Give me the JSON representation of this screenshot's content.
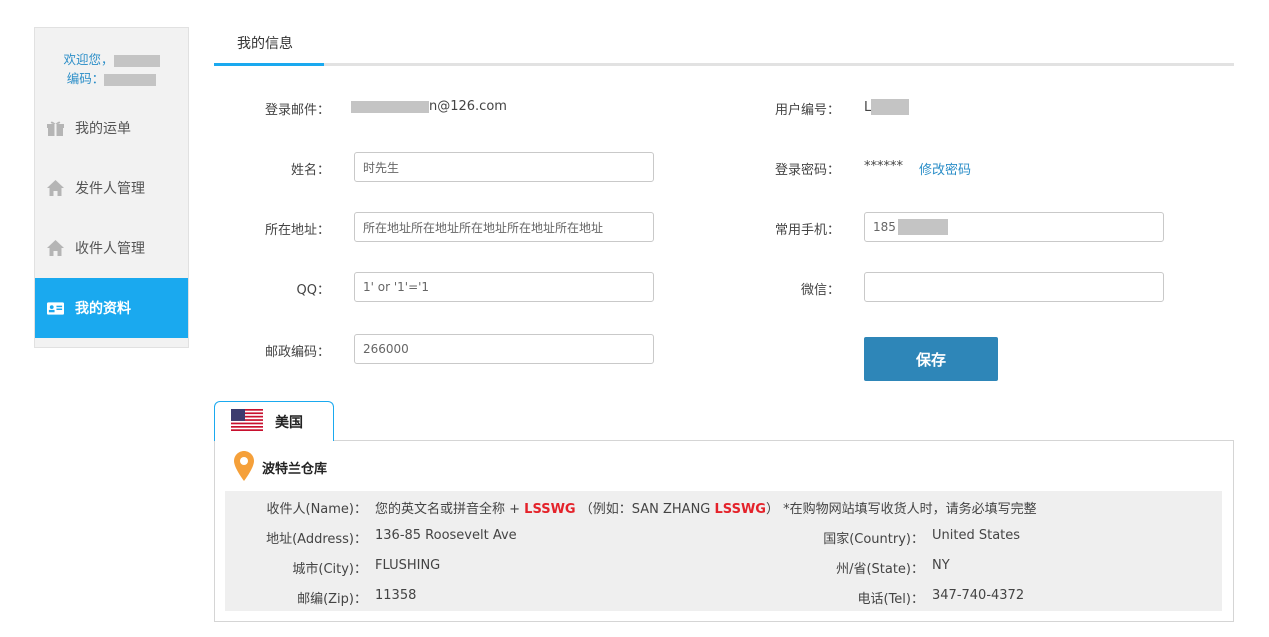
{
  "sidebar": {
    "welcome_label": "欢迎您，",
    "code_label": "编码：",
    "items": [
      {
        "label": "我的运单",
        "icon": "gift-icon"
      },
      {
        "label": "发件人管理",
        "icon": "home-icon"
      },
      {
        "label": "收件人管理",
        "icon": "home-icon"
      },
      {
        "label": "我的资料",
        "icon": "id-card-icon"
      }
    ],
    "active_index": 3
  },
  "tabs": {
    "info": "我的信息"
  },
  "form": {
    "email_label": "登录邮件：",
    "email_suffix": "n@126.com",
    "user_id_label": "用户编号：",
    "user_id_prefix": "L",
    "name_label": "姓名：",
    "name_value": "时先生",
    "password_label": "登录密码：",
    "password_value": "******",
    "change_password": "修改密码",
    "address_label": "所在地址：",
    "address_value": "所在地址所在地址所在地址所在地址所在地址",
    "phone_label": "常用手机：",
    "phone_prefix": "185",
    "qq_label": "QQ：",
    "qq_value": "1' or '1'='1",
    "wechat_label": "微信：",
    "wechat_value": "",
    "zip_label": "邮政编码：",
    "zip_value": "266000",
    "save_label": "保存"
  },
  "warehouse": {
    "country": "美国",
    "name": "波特兰仓库",
    "recipient_label": "收件人(Name)：",
    "recipient_pre": "您的英文名或拼音全称 +",
    "code": "LSSWG",
    "example_pre": "（例如：SAN ZHANG",
    "example_post": "）",
    "note": "*在购物网站填写收货人时，请务必填写完整",
    "address_label": "地址(Address)：",
    "address": "136-85 Roosevelt Ave",
    "country_label": "国家(Country)：",
    "country_value": "United States",
    "city_label": "城市(City)：",
    "city": "FLUSHING",
    "state_label": "州/省(State)：",
    "state": "NY",
    "zip_label": "邮编(Zip)：",
    "zip": "11358",
    "tel_label": "电话(Tel)：",
    "tel": "347-740-4372"
  },
  "colors": {
    "accent": "#1aa9ef",
    "button": "#2e86b8",
    "link": "#2b8ec8",
    "highlight": "#e4222a"
  }
}
